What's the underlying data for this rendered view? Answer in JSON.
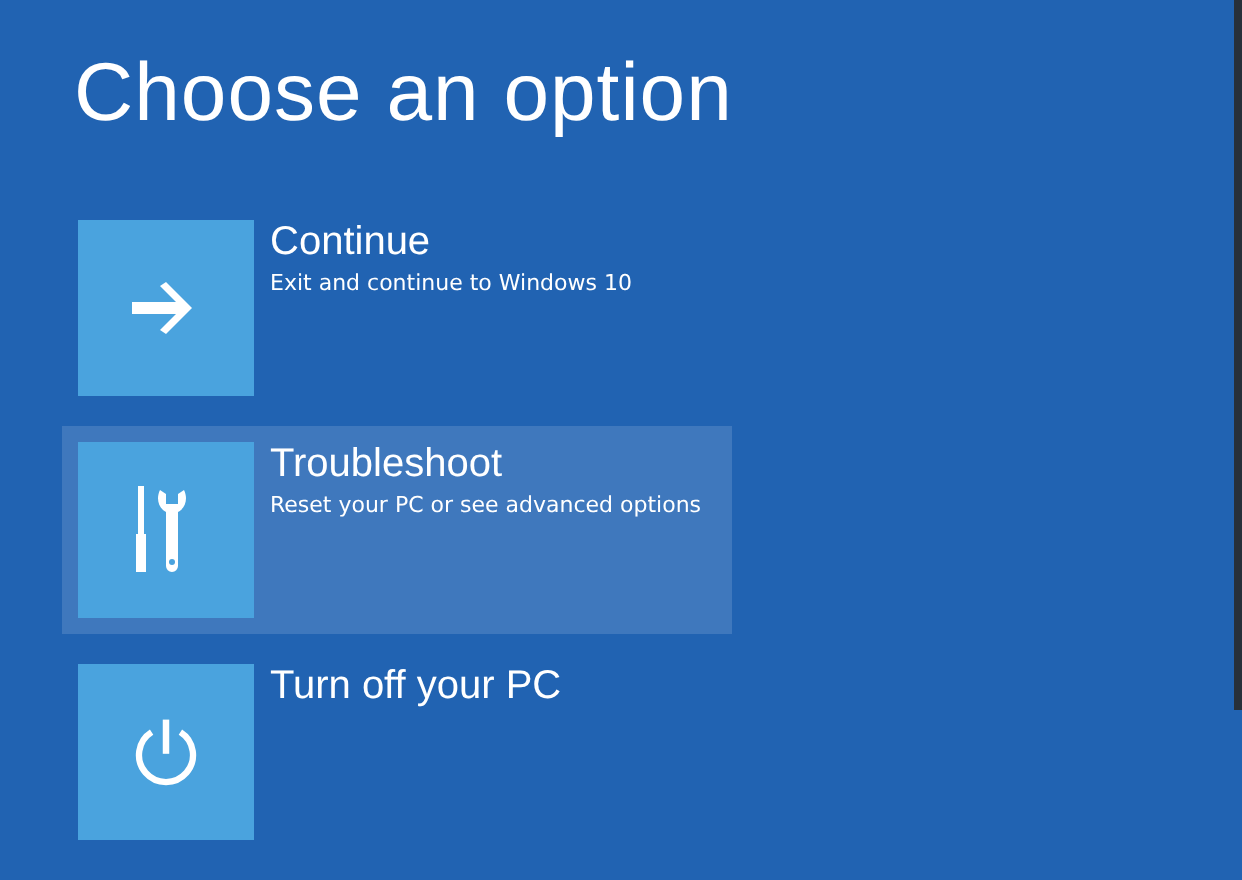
{
  "title": "Choose an option",
  "options": [
    {
      "label": "Continue",
      "description": "Exit and continue to Windows 10",
      "selected": false
    },
    {
      "label": "Troubleshoot",
      "description": "Reset your PC or see advanced options",
      "selected": true
    },
    {
      "label": "Turn off your PC",
      "selected": false
    }
  ]
}
